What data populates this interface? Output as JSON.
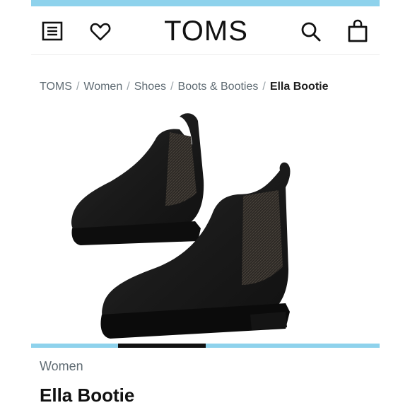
{
  "header": {
    "brand": "TOMS",
    "icons": [
      "menu-icon",
      "heart-icon",
      "search-icon",
      "shopping-bag-icon"
    ]
  },
  "breadcrumb": {
    "items": [
      "TOMS",
      "Women",
      "Shoes",
      "Boots & Booties"
    ],
    "current": "Ella Bootie",
    "separator": "/"
  },
  "carousel": {
    "slide": 2,
    "slide_count": 4
  },
  "product": {
    "category": "Women",
    "name": "Ella Bootie"
  },
  "colors": {
    "accent": "#8ed2ec",
    "text": "#111111",
    "muted": "#5f6b73",
    "boot": "#1b1b1b"
  }
}
